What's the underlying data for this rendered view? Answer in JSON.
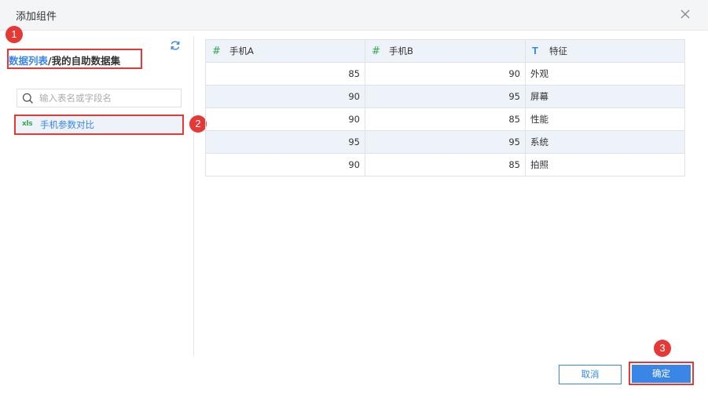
{
  "dialog": {
    "title": "添加组件"
  },
  "left": {
    "breadcrumb": {
      "link": "数据列表",
      "sep": "/",
      "current": "我的自助数据集"
    },
    "search": {
      "placeholder": "输入表名或字段名",
      "value": ""
    },
    "dataset": {
      "icon_text": "xls",
      "label": "手机参数对比"
    }
  },
  "badges": [
    "1",
    "2",
    "3"
  ],
  "table": {
    "columns": [
      {
        "type_icon": "#",
        "name": "手机A"
      },
      {
        "type_icon": "#",
        "name": "手机B"
      },
      {
        "type_icon": "T",
        "name": "特征"
      }
    ],
    "rows": [
      [
        "85",
        "90",
        "外观"
      ],
      [
        "90",
        "95",
        "屏幕"
      ],
      [
        "90",
        "85",
        "性能"
      ],
      [
        "95",
        "95",
        "系统"
      ],
      [
        "90",
        "85",
        "拍照"
      ]
    ]
  },
  "footer": {
    "cancel": "取消",
    "ok": "确定"
  },
  "colors": {
    "accent": "#3a86e6",
    "highlight": "#e53935",
    "green": "#33a852"
  }
}
